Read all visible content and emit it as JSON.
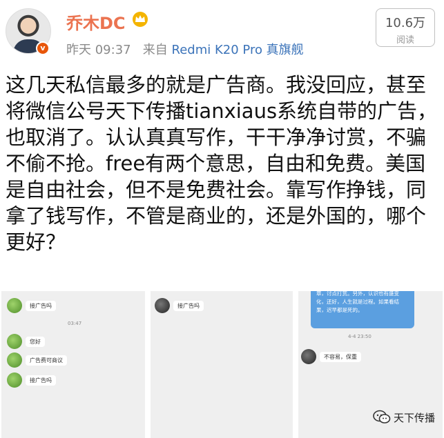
{
  "header": {
    "username": "乔木DC",
    "avatar": "user-avatar",
    "verified_badge": "v",
    "time": "昨天 09:37",
    "source_prefix": "来自",
    "source": "Redmi K20 Pro 真旗舰",
    "reads_count": "10.6万",
    "reads_label": "阅读"
  },
  "post": {
    "text": "这几天私信最多的就是广告商。我没回应，甚至将微信公号天下传播tianxiaus系统自带的广告，也取消了。认认真真写作，干干净净讨赏，不骗不偷不抢。free有两个意思，自由和免费。美国是自由社会，但不是免费社会。靠写作挣钱，同拿了钱写作，不管是商业的，还是外国的，哪个更好？"
  },
  "screenshots": {
    "s1": {
      "msg1": "接广告吗",
      "time": "03:47",
      "msg2": "您好",
      "msg3": "广告费可商议",
      "msg4": "接广告吗"
    },
    "s2": {
      "msg1": "接广告吗"
    },
    "s3": {
      "reply": "章，讨点打赏。另外，认识也有盛变化，还好，人生就是过程。如果看结果，迟早都是死的。",
      "time": "4-4 23:50",
      "msg1": "不容易，保重"
    }
  },
  "watermark": {
    "icon": "wechat-icon",
    "text": "天下传播"
  },
  "colors": {
    "username": "#eb7350",
    "source_link": "#3b73b9",
    "badge": "#e8560a",
    "reply_bubble": "#5b9fe0"
  }
}
